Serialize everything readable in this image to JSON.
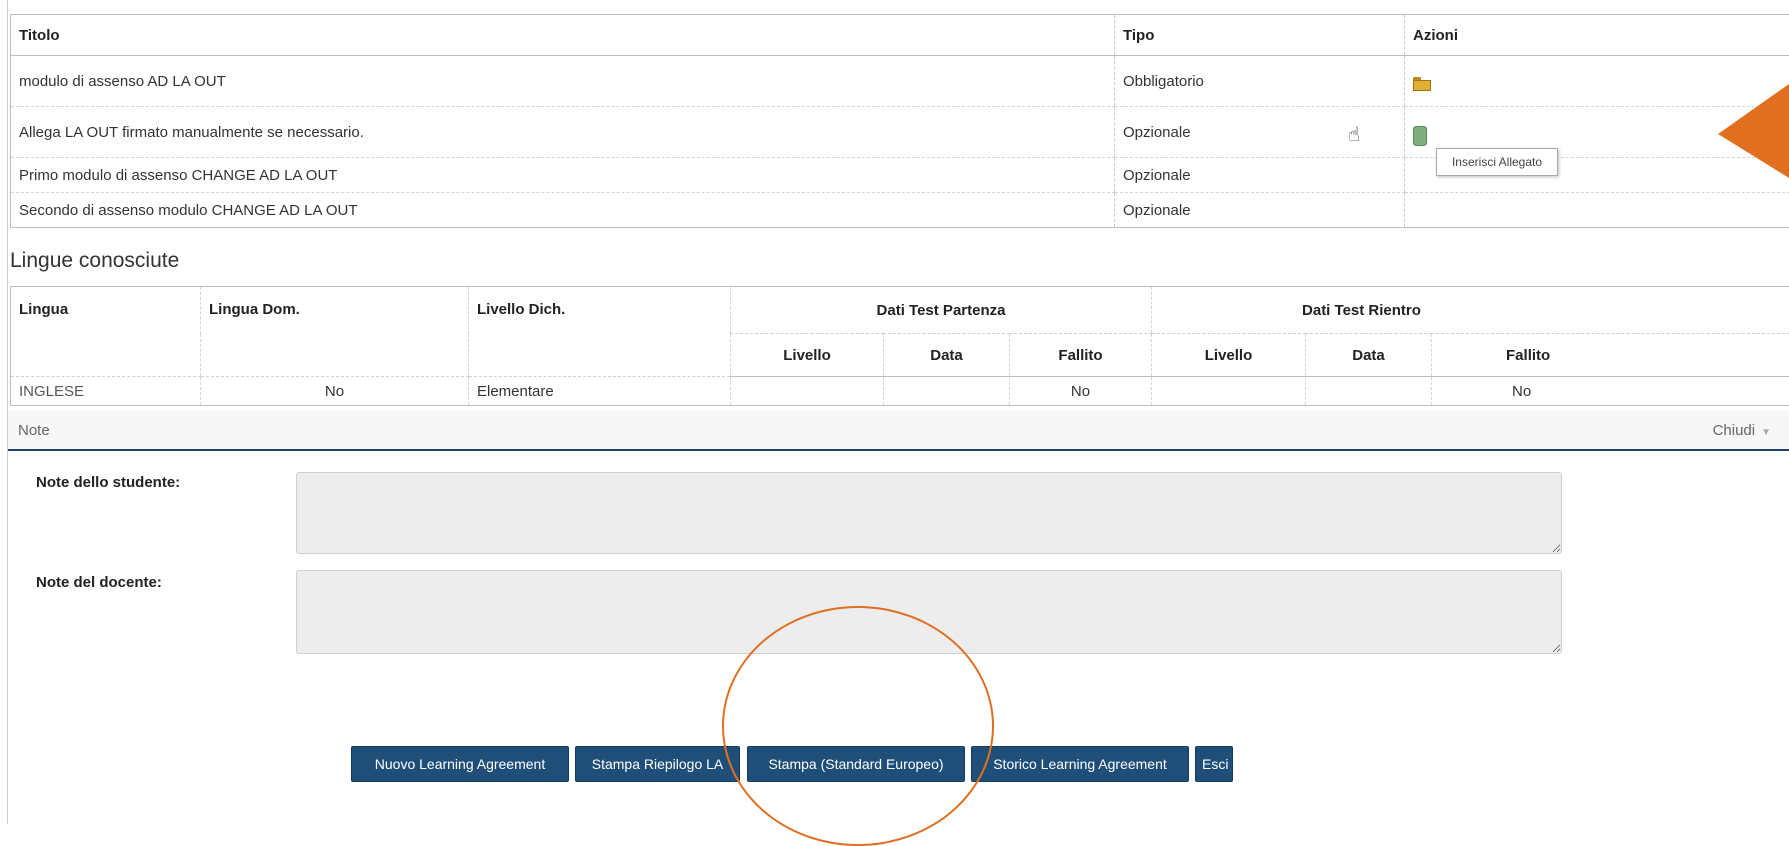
{
  "attachments_table": {
    "headers": {
      "titolo": "Titolo",
      "tipo": "Tipo",
      "azioni": "Azioni"
    },
    "rows": [
      {
        "titolo": "modulo di assenso AD LA OUT",
        "tipo": "Obbligatorio",
        "action_icon": "folder-open-icon"
      },
      {
        "titolo": "Allega LA OUT firmato manualmente se necessario.",
        "tipo": "Opzionale",
        "action_icon": "attach-icon"
      },
      {
        "titolo": "Primo modulo di assenso CHANGE AD LA OUT",
        "tipo": "Opzionale"
      },
      {
        "titolo": "Secondo di assenso modulo CHANGE AD LA OUT",
        "tipo": "Opzionale"
      }
    ],
    "tooltip": "Inserisci Allegato"
  },
  "languages": {
    "section_title": "Lingue conosciute",
    "headers": {
      "lingua": "Lingua",
      "lingua_dom": "Lingua Dom.",
      "livello_dich": "Livello Dich.",
      "partenza": "Dati Test Partenza",
      "rientro": "Dati Test Rientro",
      "livello": "Livello",
      "data": "Data",
      "fallito": "Fallito"
    },
    "rows": [
      {
        "lingua": "INGLESE",
        "lingua_dom": "No",
        "livello_dich": "Elementare",
        "part_livello": "",
        "part_data": "",
        "part_fallito": "No",
        "rient_livello": "",
        "rient_data": "",
        "rient_fallito": "No"
      }
    ]
  },
  "notes": {
    "panel_label": "Note",
    "toggle_label": "Chiudi",
    "student_label": "Note dello studente:",
    "teacher_label": "Note del docente:",
    "student_value": "",
    "teacher_value": ""
  },
  "buttons": {
    "nuovo": "Nuovo Learning Agreement",
    "stampa_riepilogo": "Stampa Riepilogo LA",
    "stampa_standard": "Stampa (Standard Europeo)",
    "storico": "Storico Learning Agreement",
    "esci": "Esci"
  },
  "colors": {
    "button": "#1f4f79",
    "annotation": "#e07020",
    "header_rule": "#1e3f6a"
  }
}
